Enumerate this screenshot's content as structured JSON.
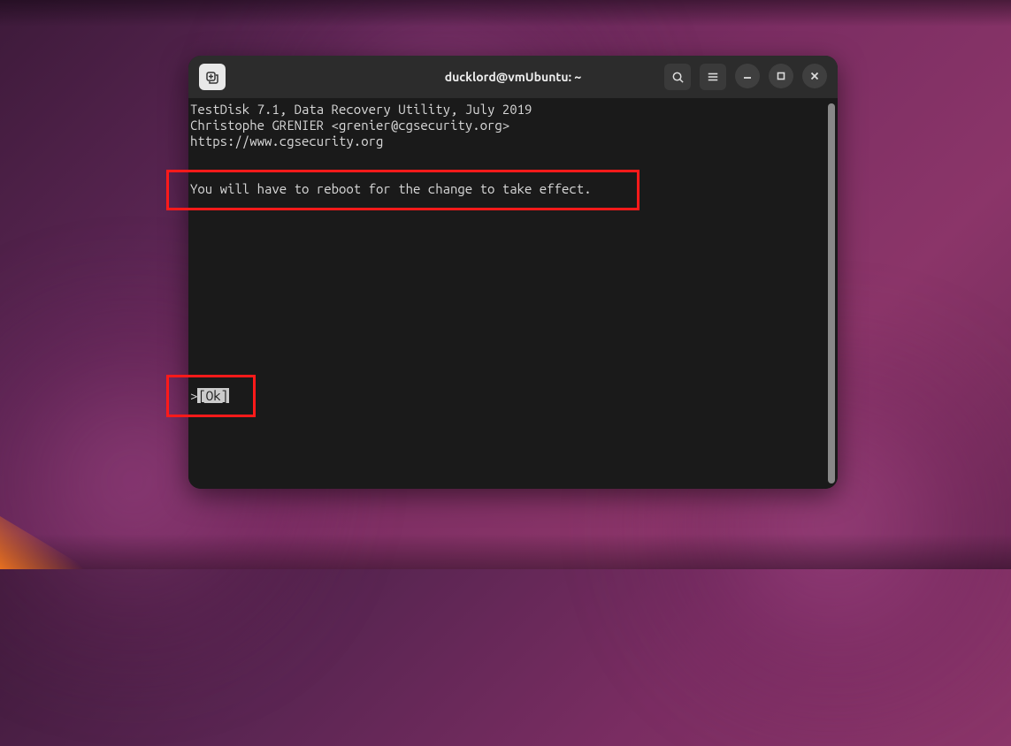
{
  "window": {
    "title": "ducklord@vmUbuntu: ~"
  },
  "terminal": {
    "line1": "TestDisk 7.1, Data Recovery Utility, July 2019",
    "line2": "Christophe GRENIER <grenier@cgsecurity.org>",
    "line3": "https://www.cgsecurity.org",
    "message": "You will have to reboot for the change to take effect.",
    "ok_prefix": ">",
    "ok_label": "[Ok]"
  },
  "titlebar": {
    "new_tab": "new-tab",
    "search": "search",
    "menu": "menu",
    "minimize": "minimize",
    "maximize": "maximize",
    "close": "close"
  }
}
